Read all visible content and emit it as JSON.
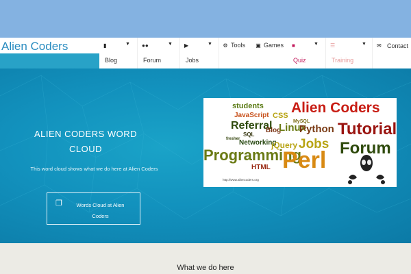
{
  "brand": {
    "name": "Alien Coders",
    "color": "#2a8cc0"
  },
  "nav": {
    "blog": {
      "label": "Blog",
      "icon": "bookmark-icon"
    },
    "forum": {
      "label": "Forum",
      "icon": "users-icon"
    },
    "jobs": {
      "label": "Jobs",
      "icon": "megaphone-icon"
    },
    "tools": {
      "label": "Tools",
      "icon": "gears-icon"
    },
    "games": {
      "label": "Games",
      "icon": "gamepad-icon"
    },
    "quiz": {
      "label": "Quiz",
      "icon": "puzzle-icon",
      "color": "#c2185b"
    },
    "training": {
      "label": "Training",
      "icon": "list-icon",
      "color": "#e69a9a"
    },
    "contact": {
      "label": "Contact",
      "icon": "envelope-icon"
    }
  },
  "hero": {
    "title": "ALIEN CODERS WORD CLOUD",
    "description": "This word cloud shows what we do here at Alien Coders",
    "button_label": "Words Cloud at Alien Coders",
    "button_icon": "copy-icon"
  },
  "wordcloud": {
    "words": {
      "students": "students",
      "alien_coders": "Alien Coders",
      "javascript": "JavaScript",
      "css": "CSS",
      "mysql": "MySQL",
      "referral": "Referral",
      "blog": "Blog",
      "linux": "Linux",
      "python": "Python",
      "tutorials": "Tutorials",
      "sql": "SQL",
      "fresher": "fresher",
      "networking": "Networking",
      "jquery": "jQuery",
      "jobs": "Jobs",
      "forum": "Forum",
      "programming": "Programming",
      "perl": "Perl",
      "html": "HTML",
      "url": "http://www.aliencoders.org"
    }
  },
  "section": {
    "title": "What we do here"
  }
}
